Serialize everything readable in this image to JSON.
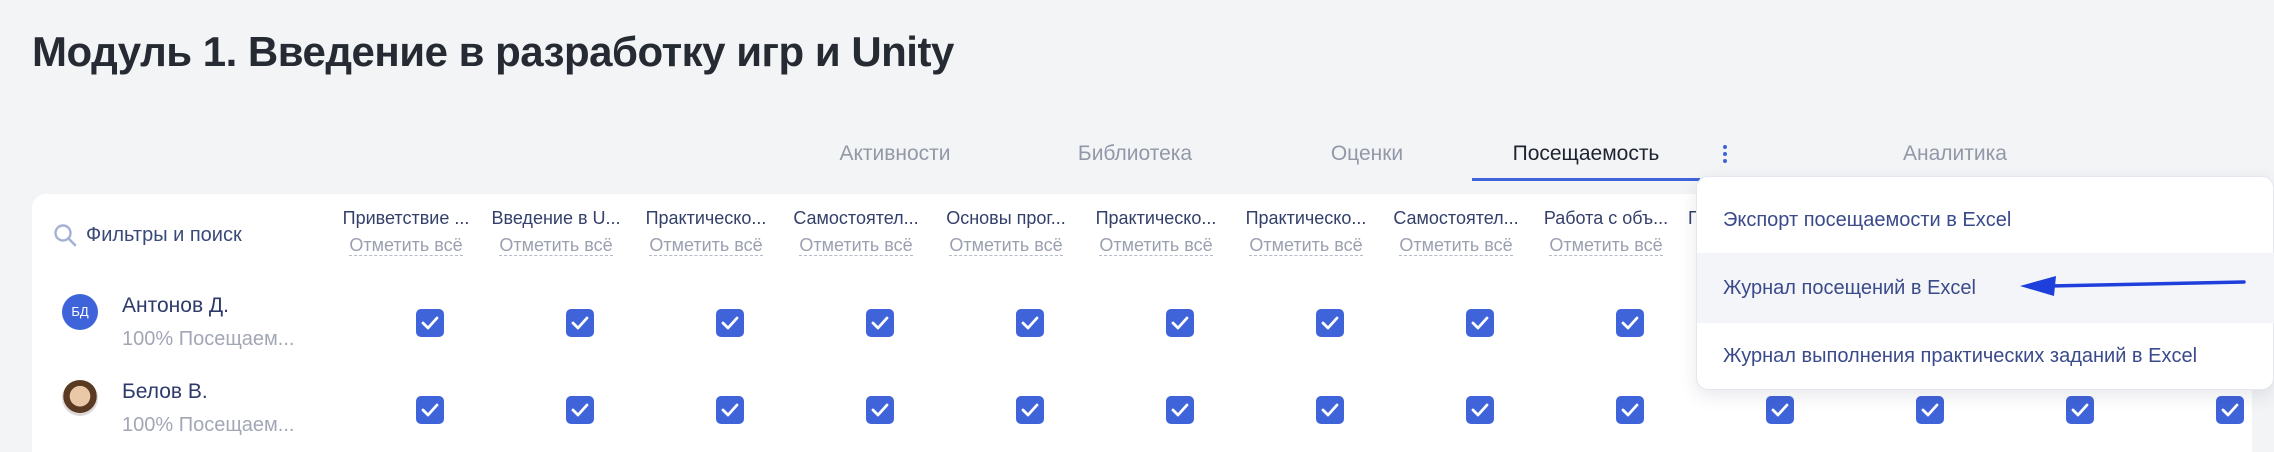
{
  "page": {
    "title": "Модуль 1. Введение в разработку игр и Unity"
  },
  "tabs": [
    {
      "label": "Активности"
    },
    {
      "label": "Библиотека"
    },
    {
      "label": "Оценки"
    },
    {
      "label": "Посещаемость",
      "active": true
    },
    {
      "label": "Аналитика"
    }
  ],
  "table": {
    "search_label": "Фильтры и поиск",
    "mark_all": "Отметить всё",
    "columns": [
      "Приветствие ...",
      "Введение в U...",
      "Практическо...",
      "Самостоятел...",
      "Основы прог...",
      "Практическо...",
      "Практическо...",
      "Самостоятел...",
      "Работа с объ...",
      "П"
    ],
    "students": [
      {
        "initials": "БД",
        "name": "Антонов Д.",
        "attendance": "100% Посещаем..."
      },
      {
        "initials": "",
        "name": "Белов В.",
        "attendance": "100% Посещаем..."
      }
    ]
  },
  "menu": {
    "items": [
      "Экспорт посещаемости в Excel",
      "Журнал посещений в Excel",
      "Журнал выполнения практических заданий в Excel"
    ]
  },
  "colors": {
    "accent": "#3f63d8",
    "annotation_arrow": "#1f3fdc"
  },
  "icons": [
    "search-icon",
    "kebab-menu-icon",
    "checkbox-checked-icon",
    "annotation-arrow"
  ]
}
